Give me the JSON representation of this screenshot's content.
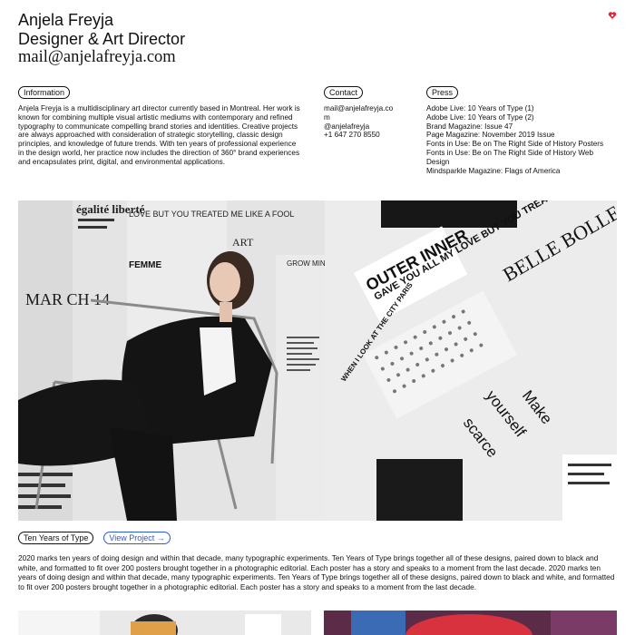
{
  "header": {
    "name": "Anjela Freyja",
    "role": "Designer & Art Director",
    "email": "mail@anjelafreyja.com"
  },
  "info": {
    "label": "Information",
    "text": "Anjela Freyja is a multidisciplinary art director currently based in Montreal. Her work is known for combining multiple visual artistic mediums with contemporary and refined typography to communicate compelling brand stories and identities. Creative projects are always approached with consideration of strategic storytelling, classic design principles, and knowledge of future trends. With ten years of professional experience in the design world, her practice now includes the direction of 360° brand experiences and encapsulates print, digital, and environmental applications."
  },
  "contact": {
    "label": "Contact",
    "email": "mail@anjelafreyja.co",
    "email_tail": "m",
    "handle": "@anjelafreyja",
    "phone": "+1 647 270 8550"
  },
  "press": {
    "label": "Press",
    "items": [
      "Adobe Live: 10 Years of Type (1)",
      "Adobe Live: 10 Years of Type (2)",
      "Brand Magazine: Issue 47",
      "Page Magazine: November 2019 Issue",
      "Fonts in Use: Be on The Right Side of History Posters",
      "Fonts in Use: Be on The Right Side of History Web Design",
      "Mindsparkle Magazine: Flags of America"
    ]
  },
  "hero_poster_text": {
    "outer_inner": "OUTER INNER",
    "gave_you": "GAVE YOU ALL MY LOVE BUT YOU TREATED ME LIKE A FOOL",
    "make": "Make",
    "yourself": "yourself",
    "scarce": "scarce",
    "when_i_look": "WHEN I LOOK AT THE CITY PARIS",
    "march": "MAR CH 14",
    "femme": "FEMME",
    "grow": "GROW MIND YOUNG HEART",
    "love_but": "LOVE BUT YOU TREATED ME LIKE A FOOL",
    "egalite": "égalité liberté",
    "art": "ART",
    "belle": "BELLE BOLLE"
  },
  "project": {
    "title": "Ten Years of Type",
    "link": "View Project →",
    "description": "2020 marks ten years of doing design and within that decade, many typographic experiments. Ten Years of Type brings together all of these designs, paired down to black and white, and formatted to fit over 200 posters brought together in a photographic editorial. Each poster has a story and speaks to a moment from the last decade. 2020 marks ten years of doing design and within that decade, many typographic experiments. Ten Years of Type brings together all of these designs, paired down to black and white, and formatted to fit over 200 posters brought together in a photographic editorial. Each poster has a story and speaks to a moment from the last decade."
  },
  "colors": {
    "link": "#2a5bd7",
    "accent_icon": "#e0283a"
  }
}
